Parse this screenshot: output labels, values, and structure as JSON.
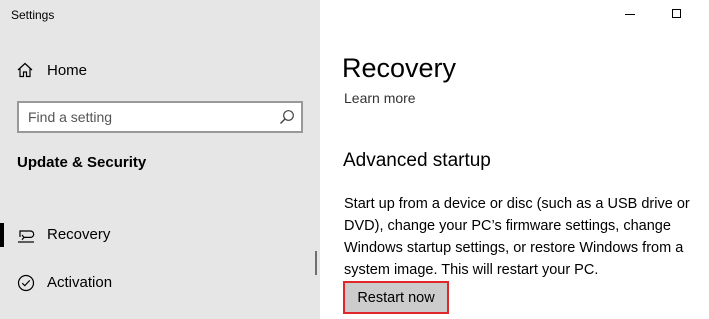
{
  "window": {
    "title": "Settings",
    "controls": {
      "minimize_icon": "minimize-icon",
      "maximize_icon": "maximize-icon"
    }
  },
  "sidebar": {
    "home": {
      "label": "Home",
      "icon": "home-icon"
    },
    "search": {
      "placeholder": "Find a setting",
      "value": "",
      "icon": "search-icon"
    },
    "section_title": "Update & Security",
    "items": [
      {
        "label": "Recovery",
        "icon": "recovery-icon",
        "selected": true
      },
      {
        "label": "Activation",
        "icon": "activation-icon",
        "selected": false
      }
    ]
  },
  "main": {
    "title": "Recovery",
    "learn_more": "Learn more",
    "advanced_startup": {
      "heading": "Advanced startup",
      "description": "Start up from a device or disc (such as a USB drive or DVD), change your PC’s firmware settings, change Windows startup settings, or restore Windows from a system image. This will restart your PC.",
      "restart_button": "Restart now"
    }
  },
  "colors": {
    "sidebar_bg": "#e6e6e6",
    "highlight_border": "#e0282b",
    "button_bg": "#cccccc"
  }
}
